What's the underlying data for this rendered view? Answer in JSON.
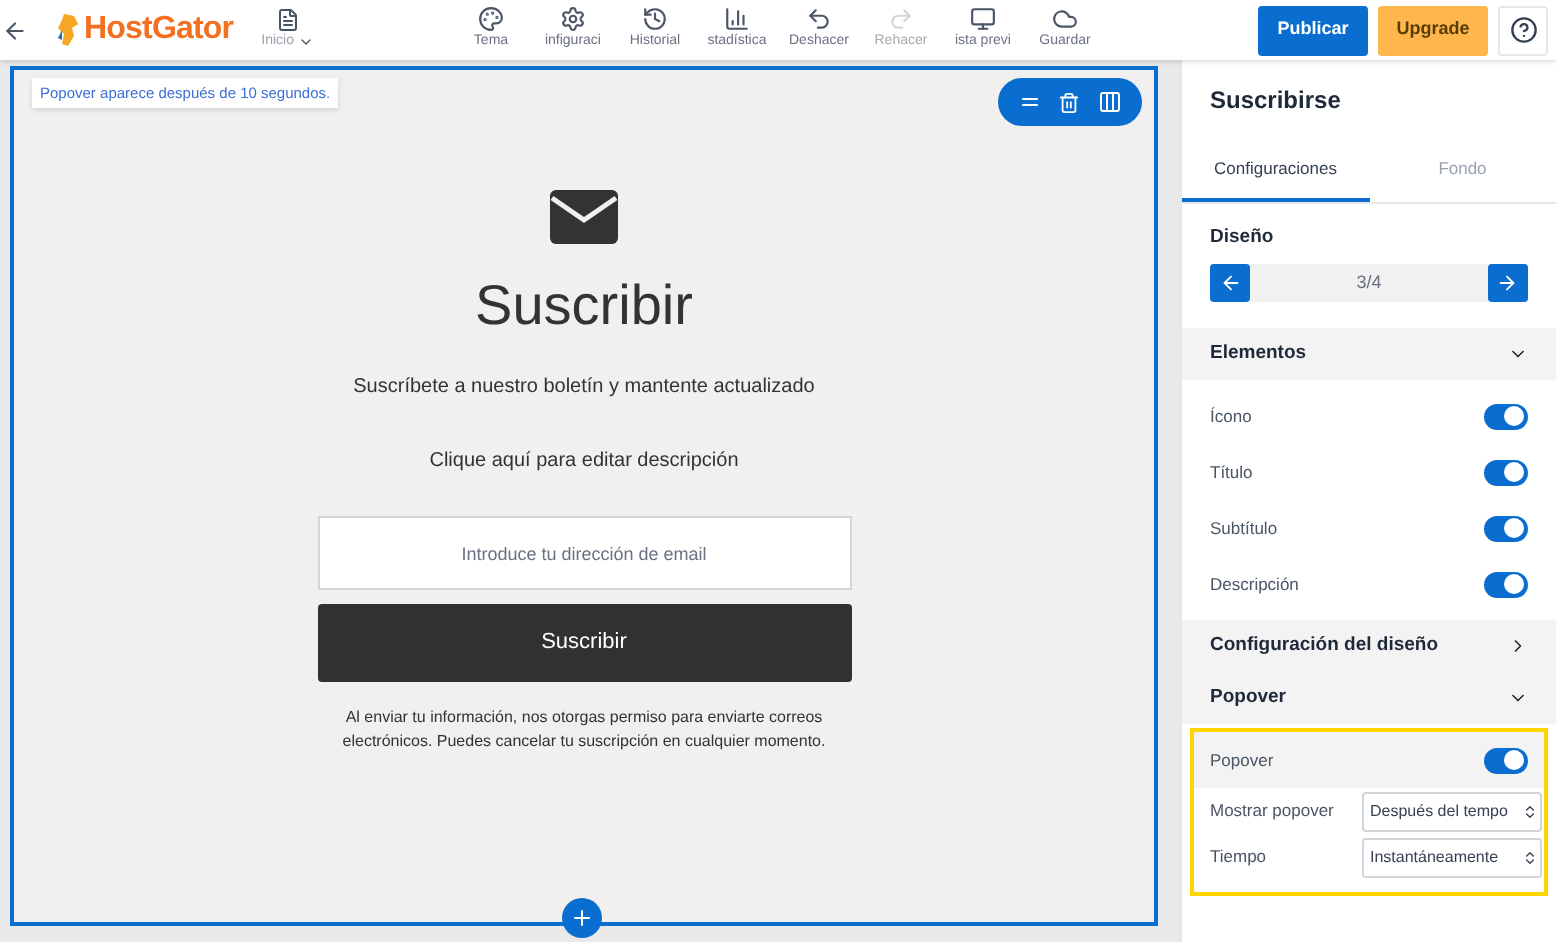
{
  "header": {
    "logo": "HostGator",
    "page_menu": "Inicio",
    "tools": [
      {
        "label": "Tema",
        "disabled": false
      },
      {
        "label": "infiguraci",
        "disabled": false
      },
      {
        "label": "Historial",
        "disabled": false
      },
      {
        "label": "stadística",
        "disabled": false
      },
      {
        "label": "Deshacer",
        "disabled": false
      },
      {
        "label": "Rehacer",
        "disabled": true
      },
      {
        "label": "ista previ",
        "disabled": false
      },
      {
        "label": "Guardar",
        "disabled": false
      }
    ],
    "publish": "Publicar",
    "upgrade": "Upgrade"
  },
  "canvas": {
    "notice": "Popover aparece después de 10 segundos.",
    "title": "Suscribir",
    "subtitle": "Suscríbete a nuestro boletín y mantente actualizado",
    "description": "Clique aquí para editar descripción",
    "email_placeholder": "Introduce tu dirección de email",
    "button": "Suscribir",
    "disclaimer": "Al enviar tu información, nos otorgas permiso para enviarte correos electrónicos. Puedes cancelar tu suscripción en cualquier momento."
  },
  "panel": {
    "title": "Suscribirse",
    "tabs": [
      {
        "label": "Configuraciones",
        "selected": true
      },
      {
        "label": "Fondo",
        "selected": false
      }
    ],
    "design": {
      "label": "Diseño",
      "page": "3/4"
    },
    "sections": [
      {
        "title": "Elementos",
        "expanded": true,
        "items": [
          {
            "kind": "toggle",
            "label": "Ícono",
            "on": true
          },
          {
            "kind": "toggle",
            "label": "Título",
            "on": true
          },
          {
            "kind": "toggle",
            "label": "Subtítulo",
            "on": true
          },
          {
            "kind": "toggle",
            "label": "Descripción",
            "on": true
          }
        ]
      },
      {
        "title": "Configuración del diseño",
        "expanded": false
      },
      {
        "title": "Popover",
        "expanded": true,
        "highlighted": true,
        "items": [
          {
            "kind": "toggle",
            "label": "Popover",
            "on": true
          },
          {
            "kind": "select",
            "label": "Mostrar popover",
            "value": "Después del tempo"
          },
          {
            "kind": "select",
            "label": "Tiempo",
            "value": "Instantáneamente"
          }
        ]
      }
    ]
  }
}
